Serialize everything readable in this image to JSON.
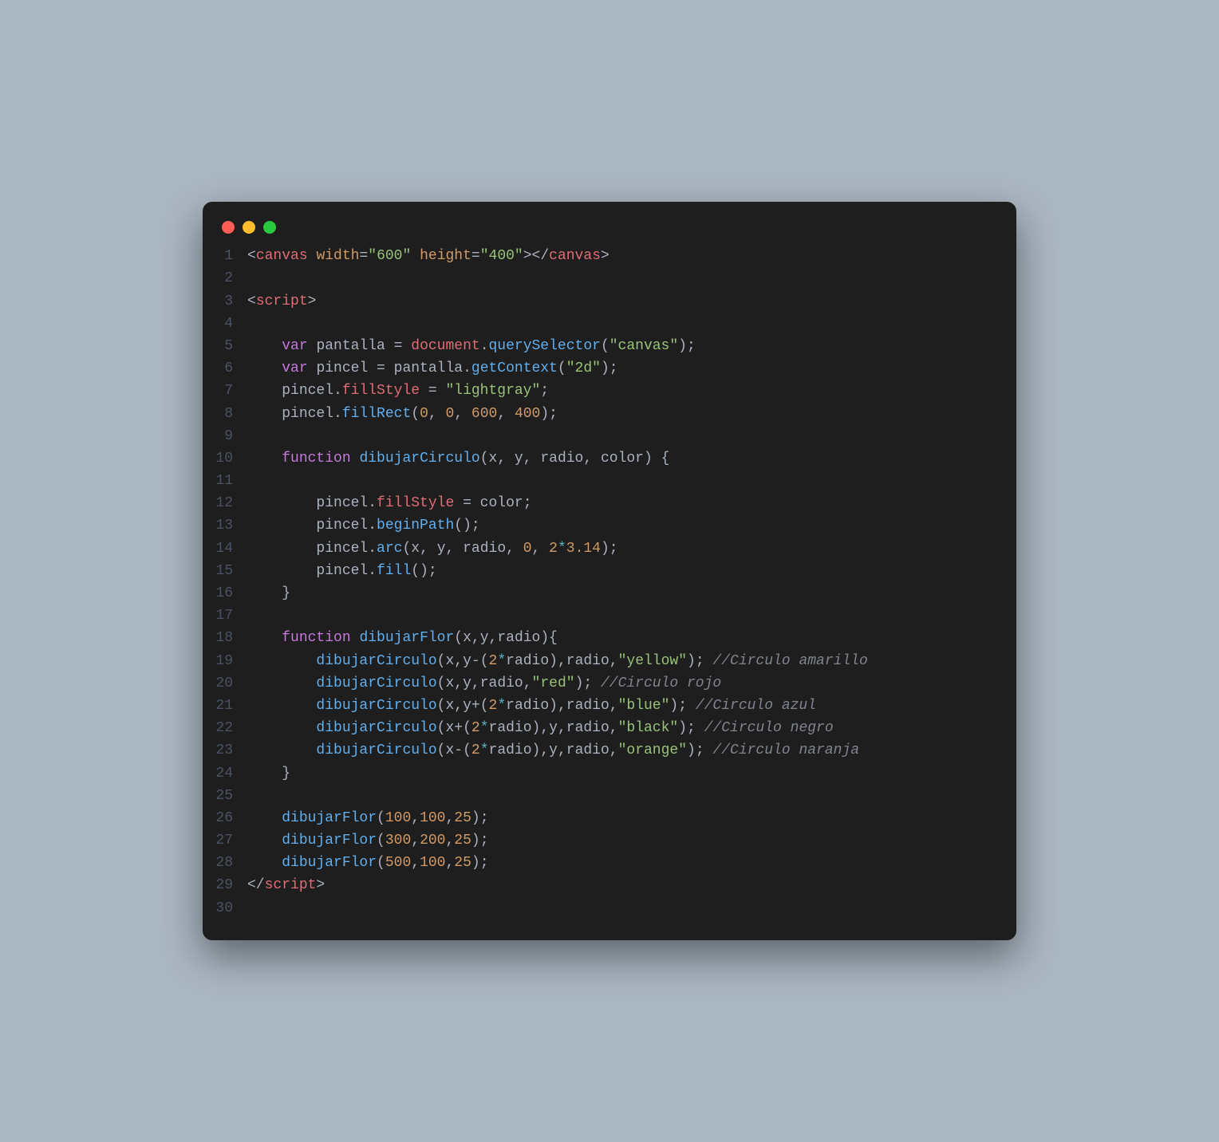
{
  "window": {
    "dots": [
      "red",
      "yellow",
      "green"
    ]
  },
  "code": {
    "language": "html-js",
    "colors": {
      "background": "#1e1e1e",
      "foreground": "#abb2bf",
      "gutter": "#4b5363",
      "red": "#e06c75",
      "orange": "#d19a66",
      "green": "#98c379",
      "purple": "#c678dd",
      "blue": "#61afef",
      "cyan": "#56b6c2",
      "yellow": "#e5c07b",
      "comment": "#7f848e"
    },
    "lines": [
      [
        [
          "p",
          "<"
        ],
        [
          "tg",
          "canvas"
        ],
        [
          "p",
          " "
        ],
        [
          "at",
          "width"
        ],
        [
          "p",
          "="
        ],
        [
          "st",
          "\"600\""
        ],
        [
          "p",
          " "
        ],
        [
          "at",
          "height"
        ],
        [
          "p",
          "="
        ],
        [
          "st",
          "\"400\""
        ],
        [
          "p",
          "></"
        ],
        [
          "tg",
          "canvas"
        ],
        [
          "p",
          ">"
        ]
      ],
      [],
      [
        [
          "p",
          "<"
        ],
        [
          "tg",
          "script"
        ],
        [
          "p",
          ">"
        ]
      ],
      [],
      [
        [
          "p",
          "    "
        ],
        [
          "kw",
          "var"
        ],
        [
          "p",
          " "
        ],
        [
          "pl",
          "pantalla"
        ],
        [
          "p",
          " = "
        ],
        [
          "id",
          "document"
        ],
        [
          "p",
          "."
        ],
        [
          "fn",
          "querySelector"
        ],
        [
          "p",
          "("
        ],
        [
          "st",
          "\"canvas\""
        ],
        [
          "p",
          ");"
        ]
      ],
      [
        [
          "p",
          "    "
        ],
        [
          "kw",
          "var"
        ],
        [
          "p",
          " "
        ],
        [
          "pl",
          "pincel"
        ],
        [
          "p",
          " = "
        ],
        [
          "pl",
          "pantalla"
        ],
        [
          "p",
          "."
        ],
        [
          "fn",
          "getContext"
        ],
        [
          "p",
          "("
        ],
        [
          "st",
          "\"2d\""
        ],
        [
          "p",
          ");"
        ]
      ],
      [
        [
          "p",
          "    "
        ],
        [
          "pl",
          "pincel"
        ],
        [
          "p",
          "."
        ],
        [
          "id",
          "fillStyle"
        ],
        [
          "p",
          " = "
        ],
        [
          "st",
          "\"lightgray\""
        ],
        [
          "p",
          ";"
        ]
      ],
      [
        [
          "p",
          "    "
        ],
        [
          "pl",
          "pincel"
        ],
        [
          "p",
          "."
        ],
        [
          "fn",
          "fillRect"
        ],
        [
          "p",
          "("
        ],
        [
          "nm",
          "0"
        ],
        [
          "p",
          ", "
        ],
        [
          "nm",
          "0"
        ],
        [
          "p",
          ", "
        ],
        [
          "nm",
          "600"
        ],
        [
          "p",
          ", "
        ],
        [
          "nm",
          "400"
        ],
        [
          "p",
          ");"
        ]
      ],
      [],
      [
        [
          "p",
          "    "
        ],
        [
          "kw",
          "function"
        ],
        [
          "p",
          " "
        ],
        [
          "fn",
          "dibujarCirculo"
        ],
        [
          "p",
          "("
        ],
        [
          "pl",
          "x"
        ],
        [
          "p",
          ", "
        ],
        [
          "pl",
          "y"
        ],
        [
          "p",
          ", "
        ],
        [
          "pl",
          "radio"
        ],
        [
          "p",
          ", "
        ],
        [
          "pl",
          "color"
        ],
        [
          "p",
          ") {"
        ]
      ],
      [],
      [
        [
          "p",
          "        "
        ],
        [
          "pl",
          "pincel"
        ],
        [
          "p",
          "."
        ],
        [
          "id",
          "fillStyle"
        ],
        [
          "p",
          " = "
        ],
        [
          "pl",
          "color"
        ],
        [
          "p",
          ";"
        ]
      ],
      [
        [
          "p",
          "        "
        ],
        [
          "pl",
          "pincel"
        ],
        [
          "p",
          "."
        ],
        [
          "fn",
          "beginPath"
        ],
        [
          "p",
          "();"
        ]
      ],
      [
        [
          "p",
          "        "
        ],
        [
          "pl",
          "pincel"
        ],
        [
          "p",
          "."
        ],
        [
          "fn",
          "arc"
        ],
        [
          "p",
          "("
        ],
        [
          "pl",
          "x"
        ],
        [
          "p",
          ", "
        ],
        [
          "pl",
          "y"
        ],
        [
          "p",
          ", "
        ],
        [
          "pl",
          "radio"
        ],
        [
          "p",
          ", "
        ],
        [
          "nm",
          "0"
        ],
        [
          "p",
          ", "
        ],
        [
          "nm",
          "2"
        ],
        [
          "op",
          "*"
        ],
        [
          "nm",
          "3.14"
        ],
        [
          "p",
          ");"
        ]
      ],
      [
        [
          "p",
          "        "
        ],
        [
          "pl",
          "pincel"
        ],
        [
          "p",
          "."
        ],
        [
          "fn",
          "fill"
        ],
        [
          "p",
          "();"
        ]
      ],
      [
        [
          "p",
          "    }"
        ]
      ],
      [],
      [
        [
          "p",
          "    "
        ],
        [
          "kw",
          "function"
        ],
        [
          "p",
          " "
        ],
        [
          "fn",
          "dibujarFlor"
        ],
        [
          "p",
          "("
        ],
        [
          "pl",
          "x"
        ],
        [
          "p",
          ","
        ],
        [
          "pl",
          "y"
        ],
        [
          "p",
          ","
        ],
        [
          "pl",
          "radio"
        ],
        [
          "p",
          "){"
        ]
      ],
      [
        [
          "p",
          "        "
        ],
        [
          "fn",
          "dibujarCirculo"
        ],
        [
          "p",
          "("
        ],
        [
          "pl",
          "x"
        ],
        [
          "p",
          ","
        ],
        [
          "pl",
          "y"
        ],
        [
          "p",
          "-("
        ],
        [
          "nm",
          "2"
        ],
        [
          "op",
          "*"
        ],
        [
          "pl",
          "radio"
        ],
        [
          "p",
          "),"
        ],
        [
          "pl",
          "radio"
        ],
        [
          "p",
          ","
        ],
        [
          "st",
          "\"yellow\""
        ],
        [
          "p",
          "); "
        ],
        [
          "cm",
          "//Circulo amarillo"
        ]
      ],
      [
        [
          "p",
          "        "
        ],
        [
          "fn",
          "dibujarCirculo"
        ],
        [
          "p",
          "("
        ],
        [
          "pl",
          "x"
        ],
        [
          "p",
          ","
        ],
        [
          "pl",
          "y"
        ],
        [
          "p",
          ","
        ],
        [
          "pl",
          "radio"
        ],
        [
          "p",
          ","
        ],
        [
          "st",
          "\"red\""
        ],
        [
          "p",
          "); "
        ],
        [
          "cm",
          "//Circulo rojo"
        ]
      ],
      [
        [
          "p",
          "        "
        ],
        [
          "fn",
          "dibujarCirculo"
        ],
        [
          "p",
          "("
        ],
        [
          "pl",
          "x"
        ],
        [
          "p",
          ","
        ],
        [
          "pl",
          "y"
        ],
        [
          "p",
          "+("
        ],
        [
          "nm",
          "2"
        ],
        [
          "op",
          "*"
        ],
        [
          "pl",
          "radio"
        ],
        [
          "p",
          "),"
        ],
        [
          "pl",
          "radio"
        ],
        [
          "p",
          ","
        ],
        [
          "st",
          "\"blue\""
        ],
        [
          "p",
          "); "
        ],
        [
          "cm",
          "//Circulo azul"
        ]
      ],
      [
        [
          "p",
          "        "
        ],
        [
          "fn",
          "dibujarCirculo"
        ],
        [
          "p",
          "("
        ],
        [
          "pl",
          "x"
        ],
        [
          "p",
          "+("
        ],
        [
          "nm",
          "2"
        ],
        [
          "op",
          "*"
        ],
        [
          "pl",
          "radio"
        ],
        [
          "p",
          "),"
        ],
        [
          "pl",
          "y"
        ],
        [
          "p",
          ","
        ],
        [
          "pl",
          "radio"
        ],
        [
          "p",
          ","
        ],
        [
          "st",
          "\"black\""
        ],
        [
          "p",
          "); "
        ],
        [
          "cm",
          "//Circulo negro"
        ]
      ],
      [
        [
          "p",
          "        "
        ],
        [
          "fn",
          "dibujarCirculo"
        ],
        [
          "p",
          "("
        ],
        [
          "pl",
          "x"
        ],
        [
          "p",
          "-("
        ],
        [
          "nm",
          "2"
        ],
        [
          "op",
          "*"
        ],
        [
          "pl",
          "radio"
        ],
        [
          "p",
          "),"
        ],
        [
          "pl",
          "y"
        ],
        [
          "p",
          ","
        ],
        [
          "pl",
          "radio"
        ],
        [
          "p",
          ","
        ],
        [
          "st",
          "\"orange\""
        ],
        [
          "p",
          "); "
        ],
        [
          "cm",
          "//Circulo naranja"
        ]
      ],
      [
        [
          "p",
          "    }"
        ]
      ],
      [],
      [
        [
          "p",
          "    "
        ],
        [
          "fn",
          "dibujarFlor"
        ],
        [
          "p",
          "("
        ],
        [
          "nm",
          "100"
        ],
        [
          "p",
          ","
        ],
        [
          "nm",
          "100"
        ],
        [
          "p",
          ","
        ],
        [
          "nm",
          "25"
        ],
        [
          "p",
          ");"
        ]
      ],
      [
        [
          "p",
          "    "
        ],
        [
          "fn",
          "dibujarFlor"
        ],
        [
          "p",
          "("
        ],
        [
          "nm",
          "300"
        ],
        [
          "p",
          ","
        ],
        [
          "nm",
          "200"
        ],
        [
          "p",
          ","
        ],
        [
          "nm",
          "25"
        ],
        [
          "p",
          ");"
        ]
      ],
      [
        [
          "p",
          "    "
        ],
        [
          "fn",
          "dibujarFlor"
        ],
        [
          "p",
          "("
        ],
        [
          "nm",
          "500"
        ],
        [
          "p",
          ","
        ],
        [
          "nm",
          "100"
        ],
        [
          "p",
          ","
        ],
        [
          "nm",
          "25"
        ],
        [
          "p",
          ");"
        ]
      ],
      [
        [
          "p",
          "</"
        ],
        [
          "tg",
          "script"
        ],
        [
          "p",
          ">"
        ]
      ],
      []
    ]
  }
}
